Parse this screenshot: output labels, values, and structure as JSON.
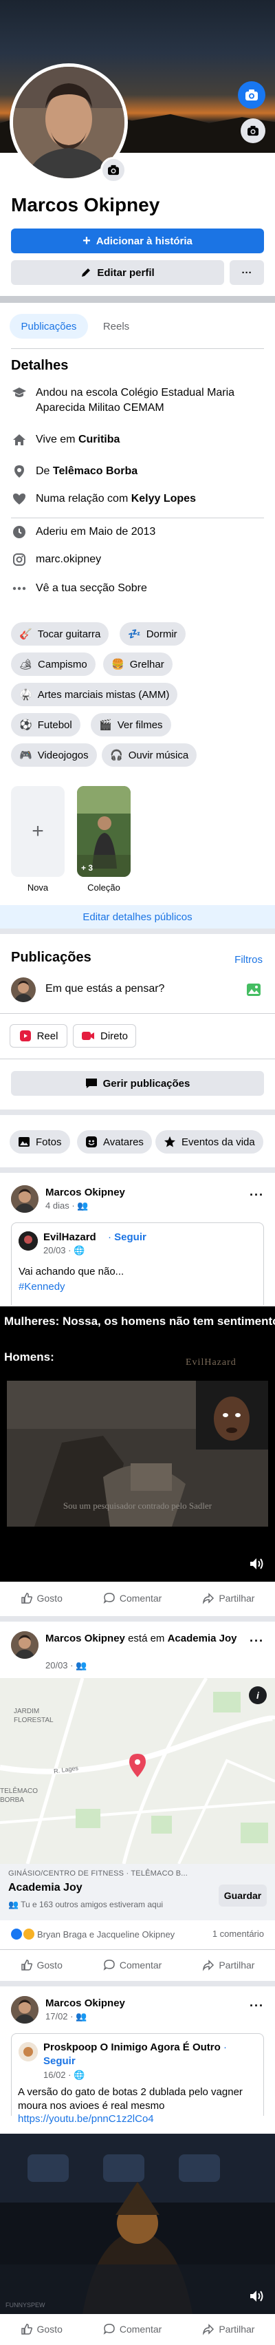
{
  "profile": {
    "name": "Marcos Okipney",
    "add_story_label": "Adicionar à história",
    "edit_profile_label": "Editar perfil",
    "more_label": "···"
  },
  "tabs": [
    "Publicações",
    "Reels"
  ],
  "details": {
    "title": "Detalhes",
    "items": [
      {
        "icon": "graduation-cap-icon",
        "pre": "Andou na escola ",
        "bold": "",
        "post": "Colégio Estadual Maria Aparecida Militao CEMAM"
      },
      {
        "icon": "home-icon",
        "pre": "Vive em ",
        "bold": "Curitiba",
        "post": ""
      },
      {
        "icon": "location-pin-icon",
        "pre": "De ",
        "bold": "Telêmaco Borba",
        "post": ""
      },
      {
        "icon": "heart-icon",
        "pre": "Numa relação com ",
        "bold": "Kelyy Lopes",
        "post": ""
      },
      {
        "icon": "clock-icon",
        "pre": "Aderiu em Maio de 2013",
        "bold": "",
        "post": ""
      },
      {
        "icon": "instagram-icon",
        "pre": "marc.okipney",
        "bold": "",
        "post": ""
      },
      {
        "icon": "more-icon",
        "pre": "Vê a tua secção Sobre",
        "bold": "",
        "post": ""
      }
    ]
  },
  "hobbies": [
    {
      "emoji": "🎸",
      "label": "Tocar guitarra"
    },
    {
      "emoji": "💤",
      "label": "Dormir"
    },
    {
      "emoji": "🏕",
      "label": "Campismo"
    },
    {
      "emoji": "🍔",
      "label": "Grelhar"
    },
    {
      "emoji": "🥋",
      "label": "Artes marciais mistas (AMM)"
    },
    {
      "emoji": "⚽",
      "label": "Futebol"
    },
    {
      "emoji": "🎬",
      "label": "Ver filmes"
    },
    {
      "emoji": "🎮",
      "label": "Videojogos"
    },
    {
      "emoji": "🎧",
      "label": "Ouvir música"
    }
  ],
  "featured": {
    "new_label": "Nova",
    "collection_label": "Coleção",
    "collection_count": "+ 3",
    "edit_public_details": "Editar detalhes públicos"
  },
  "posts_section": {
    "title": "Publicações",
    "filters": "Filtros",
    "composer_placeholder": "Em que estás a pensar?",
    "reel_label": "Reel",
    "live_label": "Direto",
    "manage_posts": "Gerir publicações",
    "shortcuts": [
      "Fotos",
      "Avatares",
      "Eventos da vida"
    ]
  },
  "post1": {
    "author": "Marcos Okipney",
    "time": "4 dias",
    "shared_author": "EvilHazard",
    "follow": "Seguir",
    "shared_time": "20/03",
    "text": "Vai achando que não...",
    "hashtag": "#Kennedy",
    "video_caption_top": "Mulheres: Nossa, os homens não tem sentimentos",
    "video_caption_homens": "Homens:",
    "video_subtitle": "Sou um pesquisador contrado pelo Sadler",
    "watermark": "EvilHazard"
  },
  "post2": {
    "author": "Marcos Okipney",
    "checkin_text": "está em",
    "place": "Academia Joy",
    "time": "20/03",
    "map_labels": [
      "JARDIM FLORESTAL",
      "TELÊMACO BORBA",
      "R. Lages"
    ],
    "place_category": "GINÁSIO/CENTRO DE FITNESS · TELÊMACO B...",
    "place_name": "Academia Joy",
    "place_visits": "Tu e 163 outros amigos estiveram aqui",
    "save_label": "Guardar",
    "reactions": "Bryan Braga e Jacqueline Okipney",
    "comments": "1 comentário"
  },
  "post3": {
    "author": "Marcos Okipney",
    "time": "17/02",
    "shared_author": "Proskpoop O Inimigo Agora É Outro",
    "follow": "Seguir",
    "shared_time": "16/02",
    "text": "A versão do gato de botas 2 dublada pelo vagner moura nos avioes é real mesmo",
    "link": "https://youtu.be/pnnC1z2lCo4",
    "watermark": "FUNNYSPEW"
  },
  "actions": {
    "like": "Gosto",
    "comment": "Comentar",
    "share": "Partilhar"
  }
}
